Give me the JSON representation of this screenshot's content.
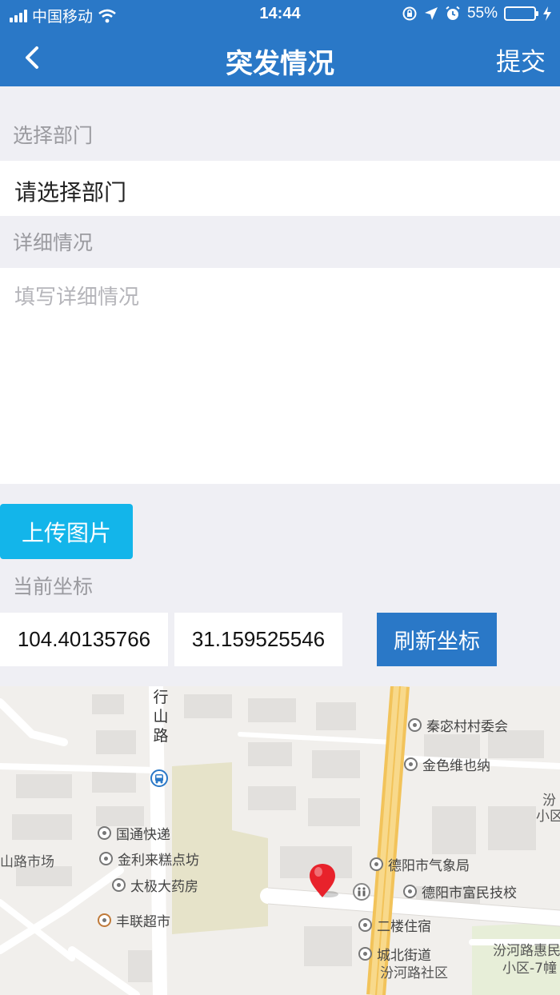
{
  "status_bar": {
    "carrier": "中国移动",
    "time": "14:44",
    "battery": "55%",
    "battery_level": 0.55
  },
  "nav": {
    "title": "突发情况",
    "submit_label": "提交"
  },
  "form": {
    "department_label": "选择部门",
    "department_placeholder": "请选择部门",
    "detail_label": "详细情况",
    "detail_placeholder": "填写详细情况",
    "upload_label": "上传图片",
    "coord_label": "当前坐标",
    "longitude": "104.40135766",
    "latitude": "31.159525546",
    "refresh_label": "刷新坐标"
  },
  "map": {
    "road_label": "行山路",
    "pois": [
      "秦宓村村委会",
      "金色维也纳",
      "国通快递",
      "金利来糕点坊",
      "太极大药房",
      "丰联超市",
      "德阳市气象局",
      "德阳市富民技校",
      "二楼住宿",
      "城北街道",
      "汾河路社区"
    ],
    "edge_labels": [
      "山路市场",
      "汾河路惠民",
      "小区-7幢",
      "汾",
      "小区"
    ]
  },
  "colors": {
    "primary": "#2a78c7",
    "upload": "#13b5ea",
    "background": "#efeff4"
  }
}
